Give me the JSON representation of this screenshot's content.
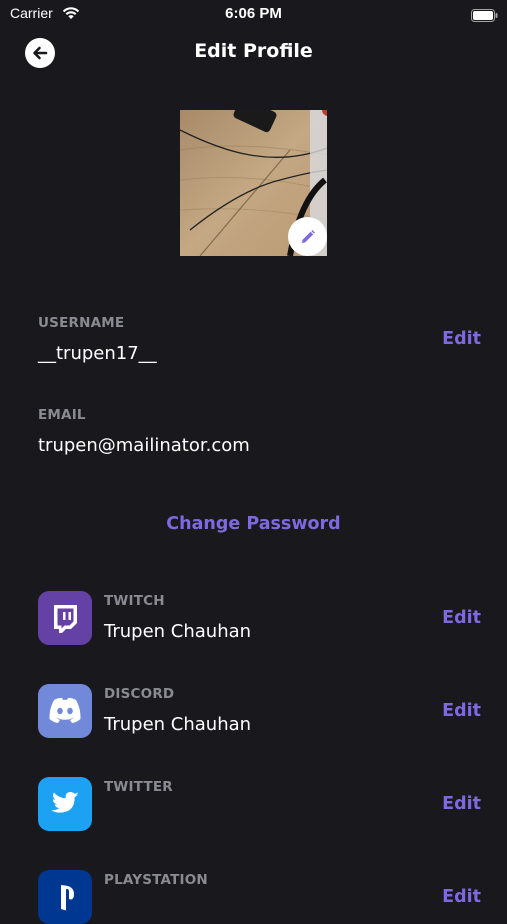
{
  "status_bar": {
    "carrier": "Carrier",
    "time": "6:06 PM"
  },
  "header": {
    "title": "Edit Profile",
    "back_icon": "arrow-left-icon"
  },
  "profile": {
    "edit_photo_icon": "pencil-icon"
  },
  "fields": {
    "username": {
      "label": "USERNAME",
      "value": "__trupen17__",
      "edit_label": "Edit"
    },
    "email": {
      "label": "EMAIL",
      "value": "trupen@mailinator.com"
    }
  },
  "change_password_label": "Change Password",
  "accounts": [
    {
      "platform": "TWITCH",
      "name": "Trupen Chauhan",
      "edit_label": "Edit",
      "icon": "twitch-icon",
      "color": "#6441a5"
    },
    {
      "platform": "DISCORD",
      "name": "Trupen Chauhan",
      "edit_label": "Edit",
      "icon": "discord-icon",
      "color": "#7289da"
    },
    {
      "platform": "TWITTER",
      "name": "",
      "edit_label": "Edit",
      "icon": "twitter-icon",
      "color": "#1da1f2"
    },
    {
      "platform": "PLAYSTATION",
      "name": "",
      "edit_label": "Edit",
      "icon": "playstation-icon",
      "color": "#003791"
    }
  ],
  "colors": {
    "background": "#19181c",
    "accent": "#7e69e0",
    "label": "#8a8a93"
  }
}
